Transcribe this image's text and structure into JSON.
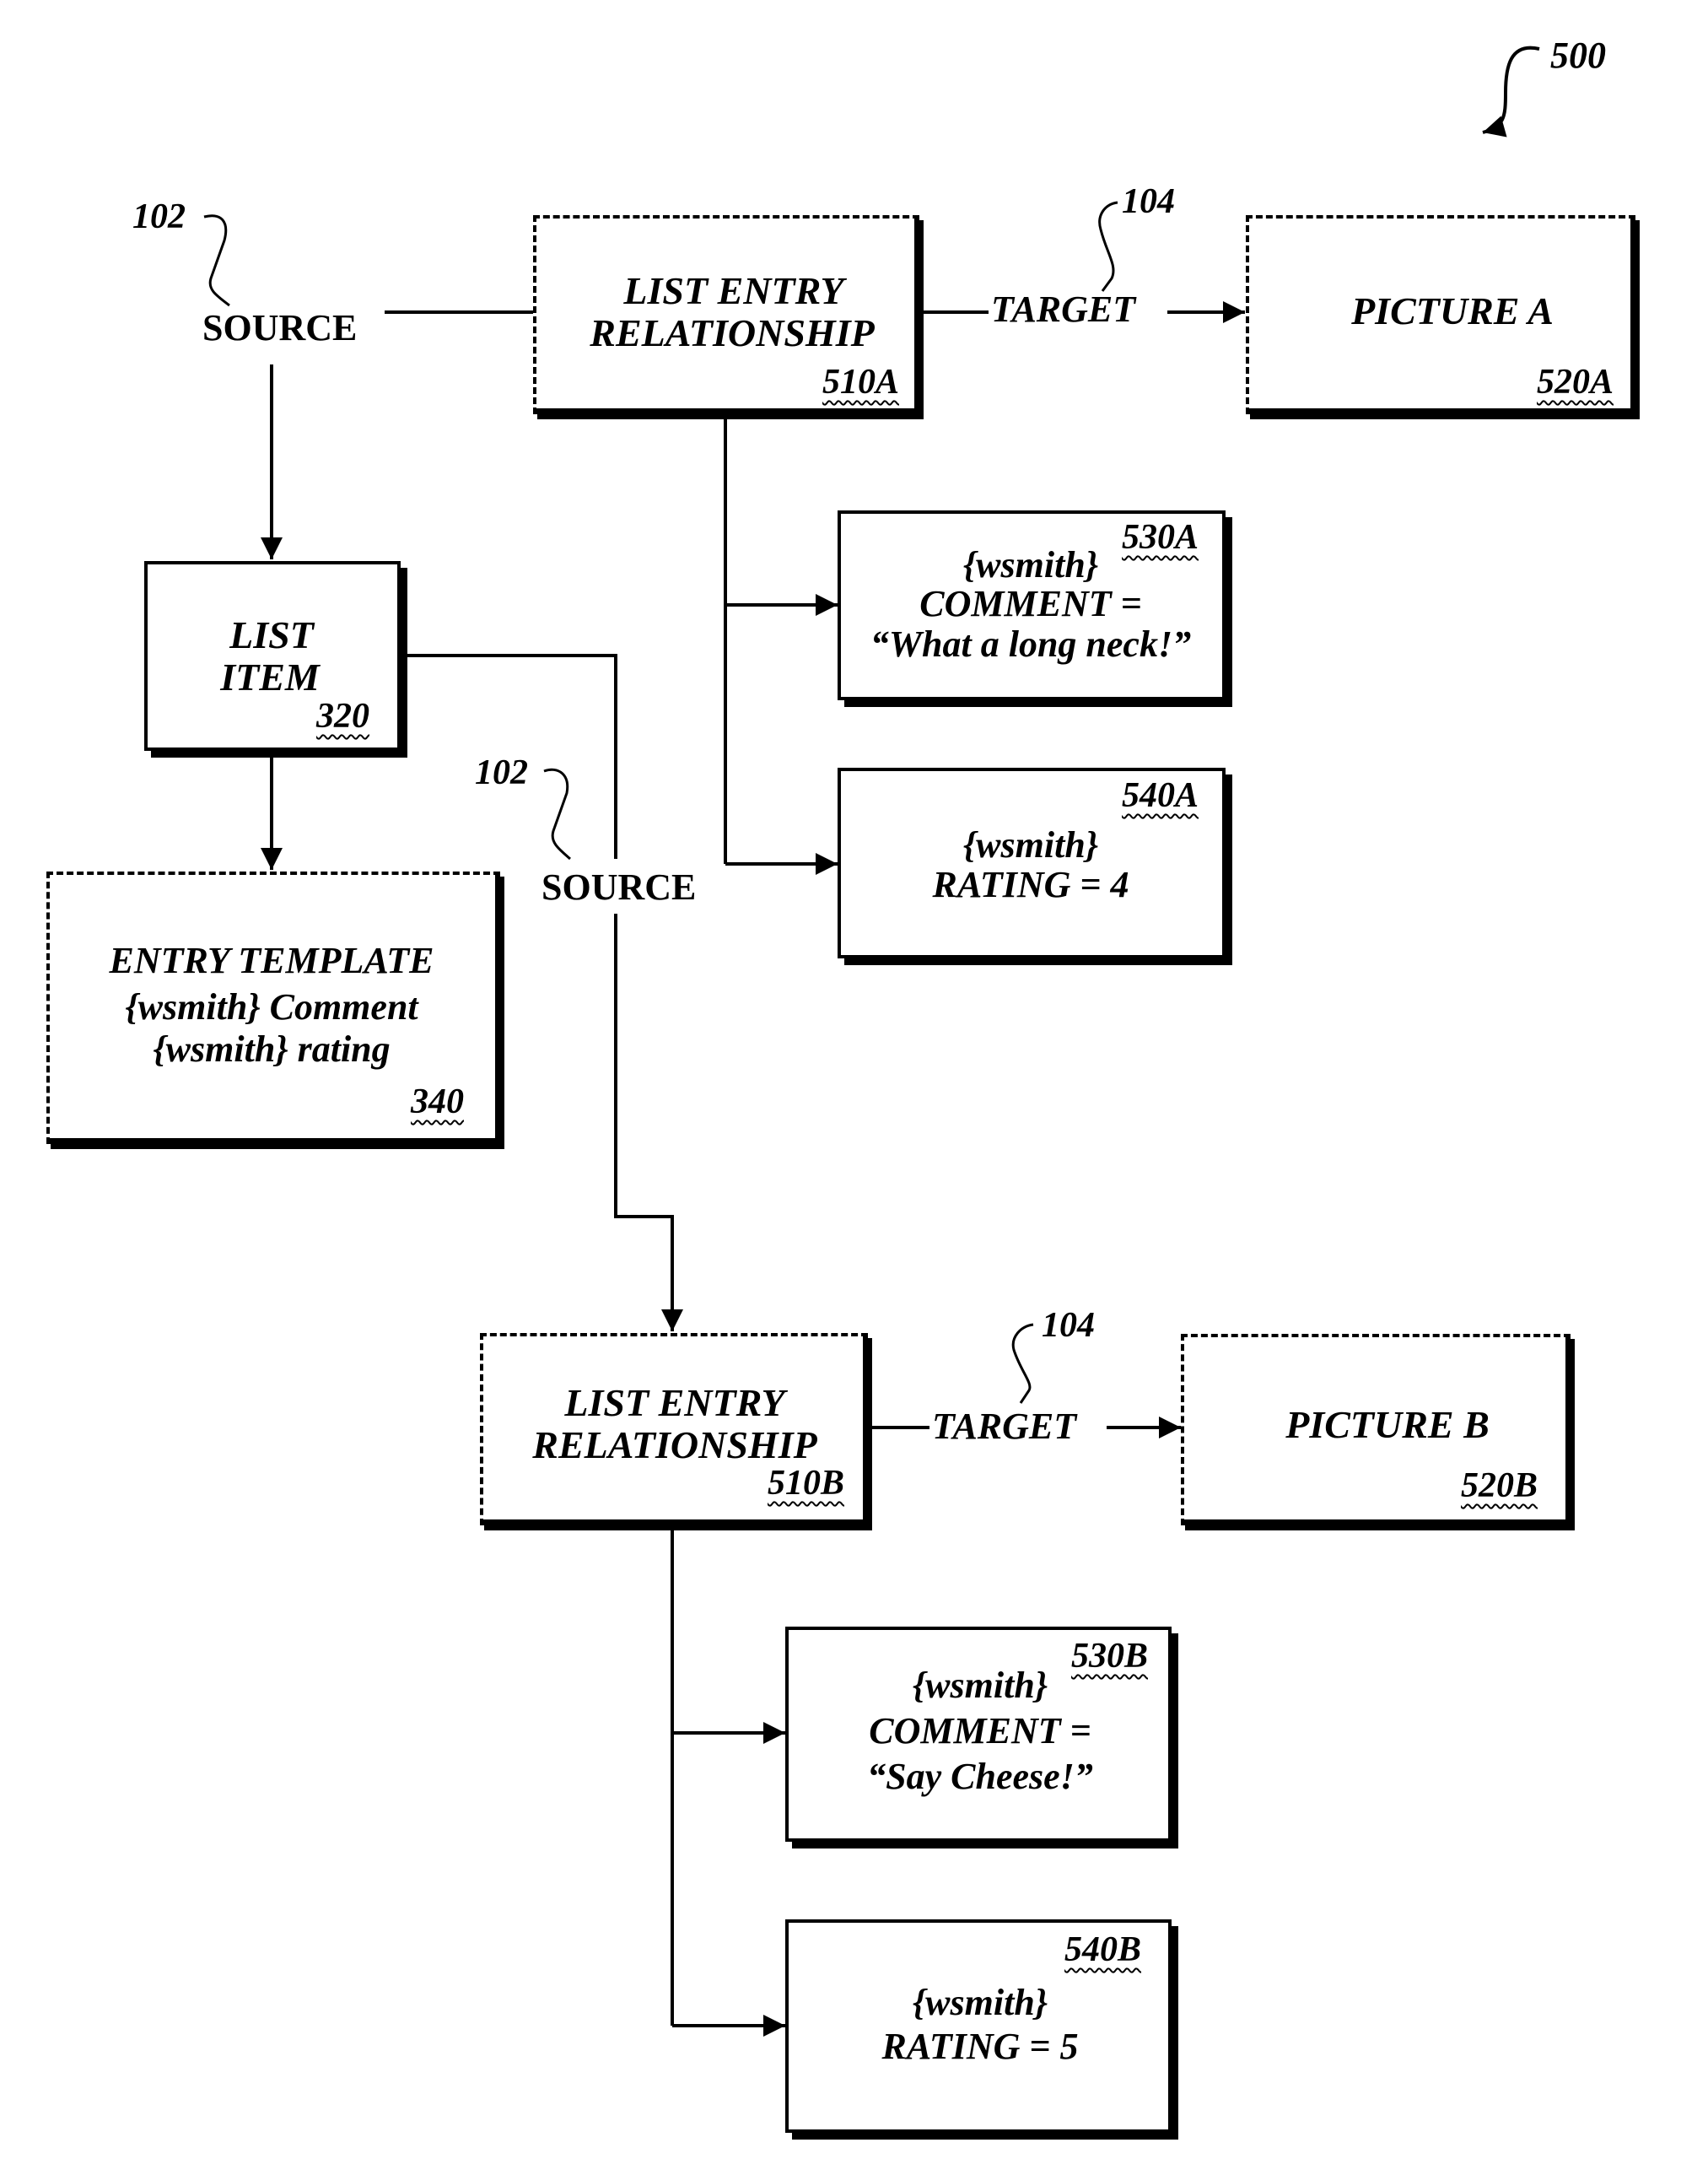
{
  "figure": {
    "number": "500"
  },
  "labels": {
    "source_ref": "102",
    "target_ref": "104",
    "source": "SOURCE",
    "target": "TARGET"
  },
  "nodes": {
    "list_entry_a": {
      "line1": "LIST ENTRY",
      "line2": "RELATIONSHIP",
      "ref": "510A",
      "style": "dashed"
    },
    "picture_a": {
      "line1": "PICTURE A",
      "ref": "520A",
      "style": "dashed"
    },
    "comment_a": {
      "user": "{wsmith}",
      "field": "COMMENT =",
      "value": "“What a long neck!”",
      "ref": "530A",
      "style": "solid"
    },
    "rating_a": {
      "user": "{wsmith}",
      "field": "RATING = 4",
      "ref": "540A",
      "style": "solid"
    },
    "list_item": {
      "line1": "LIST",
      "line2": "ITEM",
      "ref": "320",
      "style": "solid"
    },
    "entry_template": {
      "line1": "ENTRY TEMPLATE",
      "line2": "{wsmith} Comment",
      "line3": "{wsmith} rating",
      "ref": "340",
      "style": "dashed"
    },
    "list_entry_b": {
      "line1": "LIST ENTRY",
      "line2": "RELATIONSHIP",
      "ref": "510B",
      "style": "dashed"
    },
    "picture_b": {
      "line1": "PICTURE B",
      "ref": "520B",
      "style": "dashed"
    },
    "comment_b": {
      "user": "{wsmith}",
      "field": "COMMENT =",
      "value": "“Say Cheese!”",
      "ref": "530B",
      "style": "solid"
    },
    "rating_b": {
      "user": "{wsmith}",
      "field": "RATING = 5",
      "ref": "540B",
      "style": "solid"
    }
  },
  "edges": [
    {
      "from": "source_top",
      "to": "list_entry_a",
      "label": "SOURCE"
    },
    {
      "from": "list_entry_a",
      "to": "picture_a",
      "label": "TARGET"
    },
    {
      "from": "list_entry_a",
      "to": "comment_a"
    },
    {
      "from": "list_entry_a",
      "to": "rating_a"
    },
    {
      "from": "source_top",
      "to": "list_item"
    },
    {
      "from": "list_item",
      "to": "entry_template"
    },
    {
      "from": "list_item",
      "to": "list_entry_b",
      "label": "SOURCE"
    },
    {
      "from": "list_entry_b",
      "to": "picture_b",
      "label": "TARGET"
    },
    {
      "from": "list_entry_b",
      "to": "comment_b"
    },
    {
      "from": "list_entry_b",
      "to": "rating_b"
    }
  ]
}
